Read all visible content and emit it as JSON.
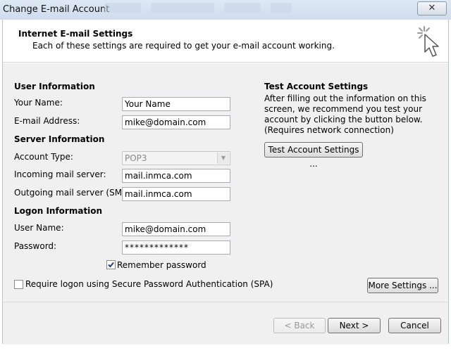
{
  "window": {
    "title": "Change E-mail Account",
    "close_glyph": "✕"
  },
  "header": {
    "title": "Internet E-mail Settings",
    "subtitle": "Each of these settings are required to get your e-mail account working.",
    "icon": "cursor-click-icon"
  },
  "user_info": {
    "heading": "User Information",
    "name_label": "Your Name:",
    "name_value": "Your Name",
    "email_label": "E-mail Address:",
    "email_value": "mike@domain.com"
  },
  "server_info": {
    "heading": "Server Information",
    "account_type_label": "Account Type:",
    "account_type_value": "POP3",
    "incoming_label": "Incoming mail server:",
    "incoming_value": "mail.inmca.com",
    "outgoing_label": "Outgoing mail server (SMTP):",
    "outgoing_value": "mail.inmca.com"
  },
  "logon_info": {
    "heading": "Logon Information",
    "username_label": "User Name:",
    "username_value": "mike@domain.com",
    "password_label": "Password:",
    "password_value": "*************",
    "remember_label": "Remember password",
    "remember_checked": true,
    "spa_label": "Require logon using Secure Password Authentication (SPA)",
    "spa_checked": false
  },
  "test": {
    "heading": "Test Account Settings",
    "description": "After filling out the information on this screen, we recommend you test your account by clicking the button below. (Requires network connection)",
    "button": "Test Account Settings ..."
  },
  "buttons": {
    "more_settings": "More Settings ...",
    "back": "< Back",
    "next": "Next >",
    "cancel": "Cancel"
  },
  "colors": {
    "titlebar": "#cfdcee",
    "dialog_bg": "#f0f0f0",
    "check_mark": "#1a3a8a"
  }
}
